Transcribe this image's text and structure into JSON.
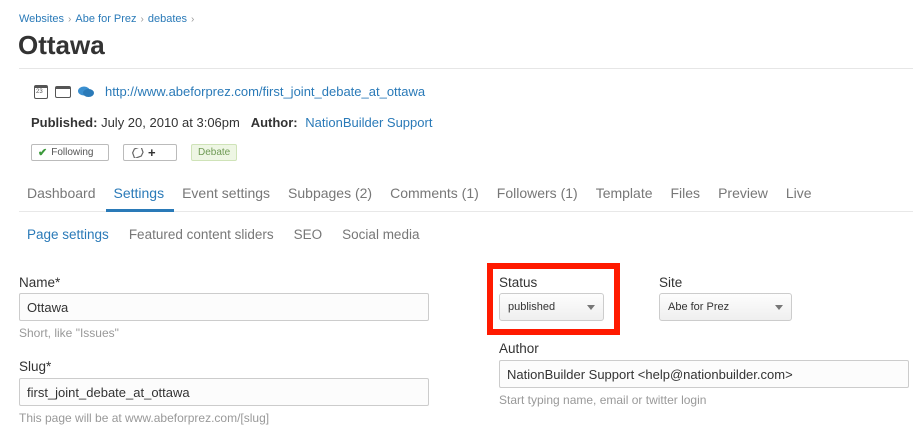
{
  "breadcrumb": [
    "Websites",
    "Abe for Prez",
    "debates"
  ],
  "page_title": "Ottawa",
  "meta": {
    "url": "http://www.abeforprez.com/first_joint_debate_at_ottawa",
    "published_label": "Published:",
    "published_value": "July 20, 2010 at 3:06pm",
    "author_label": "Author:",
    "author_value": "NationBuilder Support"
  },
  "tags": {
    "following": "Following",
    "add_tag": "+",
    "debate": "Debate"
  },
  "tabs": [
    "Dashboard",
    "Settings",
    "Event settings",
    "Subpages (2)",
    "Comments (1)",
    "Followers (1)",
    "Template",
    "Files",
    "Preview",
    "Live"
  ],
  "active_tab": "Settings",
  "subtabs": [
    "Page settings",
    "Featured content sliders",
    "SEO",
    "Social media"
  ],
  "active_subtab": "Page settings",
  "form": {
    "name_label": "Name*",
    "name_value": "Ottawa",
    "name_hint": "Short, like \"Issues\"",
    "slug_label": "Slug*",
    "slug_value": "first_joint_debate_at_ottawa",
    "slug_hint": "This page will be at www.abeforprez.com/[slug]",
    "status_label": "Status",
    "status_value": "published",
    "site_label": "Site",
    "site_value": "Abe for Prez",
    "author_label": "Author",
    "author_value": "NationBuilder Support <help@nationbuilder.com>",
    "author_hint": "Start typing name, email or twitter login"
  },
  "colors": {
    "link": "#2a7ab8",
    "highlight": "#ff1a00"
  }
}
